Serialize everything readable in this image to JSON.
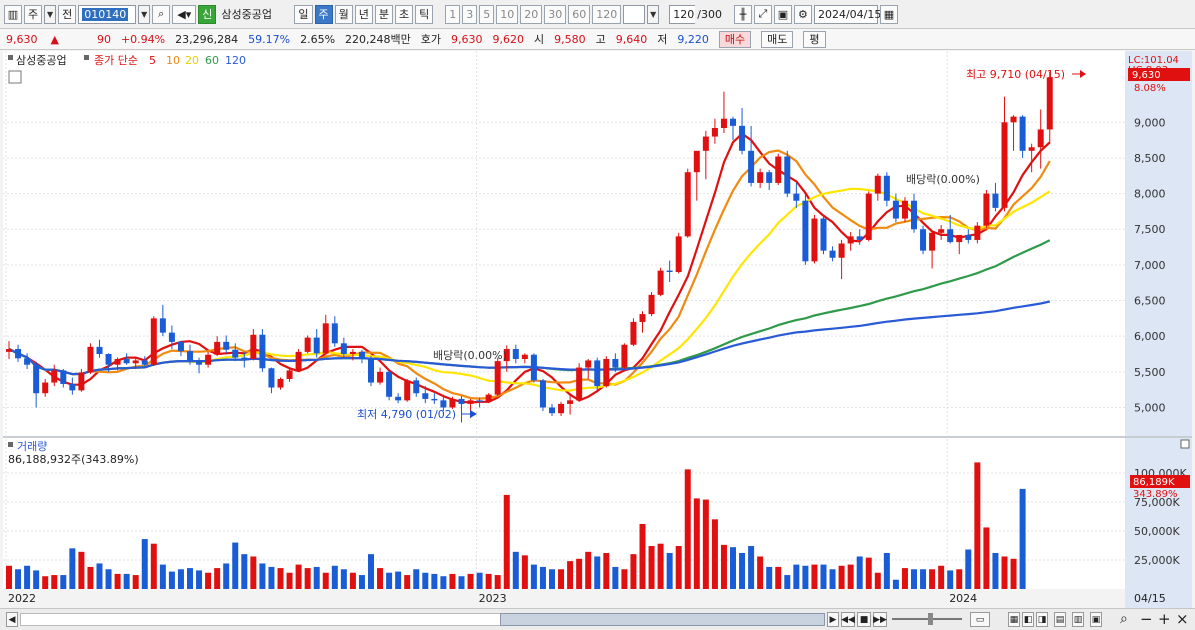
{
  "toolbar": {
    "market": "주",
    "prev_label": "전",
    "stock_code": "010140",
    "new_label": "신",
    "stock_name": "삼성중공업",
    "periods": [
      "일",
      "주",
      "월",
      "년",
      "분",
      "초",
      "틱"
    ],
    "active_period": "주",
    "intervals": [
      "1",
      "3",
      "5",
      "10",
      "20",
      "30",
      "60",
      "120"
    ],
    "count_value": "120",
    "count_total": "/300",
    "date_value": "2024/04/15"
  },
  "info": {
    "price": "9,630",
    "change_arrow": "▲",
    "change": "90",
    "change_pct": "+0.94%",
    "volume": "23,296,284",
    "vol_ratio": "59.17%",
    "turnover": "2.65%",
    "amount": "220,248백만",
    "quote_label": "호가",
    "ask": "9,630",
    "bid": "9,620",
    "open_label": "시",
    "open": "9,580",
    "high_label": "고",
    "high": "9,640",
    "low_label": "저",
    "low": "9,220",
    "buy_label": "매수",
    "sell_label": "매도",
    "eval_label": "평"
  },
  "chart_data": {
    "type": "candlestick",
    "title": "삼성중공업",
    "price_legend": {
      "label": "종가 단순",
      "ma_periods": [
        "5",
        "10",
        "20",
        "60",
        "120"
      ],
      "ma_colors": [
        "#e01010",
        "#f08a10",
        "#ffe600",
        "#2e9a4a",
        "#2a5bd6"
      ]
    },
    "lc_label": "LC:101.04",
    "hc_label": "HC:8.03",
    "current_price_label": "9,630",
    "current_pct_label": "8.08%",
    "ylim": [
      4600,
      10000
    ],
    "y_ticks": [
      5000,
      5500,
      6000,
      6500,
      7000,
      7500,
      8000,
      8500,
      9000
    ],
    "y_tick_labels": [
      "5,000",
      "5,500",
      "6,000",
      "6,500",
      "7,000",
      "7,500",
      "8,000",
      "8,500",
      "9,000"
    ],
    "x_labels": [
      "2022",
      "2023",
      "2024"
    ],
    "x_label_index": [
      0,
      52,
      104
    ],
    "last_date_label": "04/15",
    "annotations": {
      "high": "최고 9,710 (04/15)",
      "low": "최저 4,790 (01/02)",
      "dividend": "배당락(0.00%)"
    },
    "candles": [
      [
        5780,
        5930,
        5680,
        5820
      ],
      [
        5820,
        5880,
        5640,
        5690
      ],
      [
        5690,
        5760,
        5540,
        5600
      ],
      [
        5600,
        5640,
        5000,
        5200
      ],
      [
        5200,
        5400,
        5150,
        5350
      ],
      [
        5350,
        5600,
        5300,
        5520
      ],
      [
        5520,
        5540,
        5280,
        5330
      ],
      [
        5330,
        5420,
        5180,
        5240
      ],
      [
        5240,
        5540,
        5220,
        5490
      ],
      [
        5490,
        5900,
        5470,
        5850
      ],
      [
        5850,
        5950,
        5700,
        5750
      ],
      [
        5750,
        5760,
        5500,
        5600
      ],
      [
        5600,
        5700,
        5520,
        5680
      ],
      [
        5680,
        5760,
        5600,
        5620
      ],
      [
        5620,
        5700,
        5540,
        5660
      ],
      [
        5660,
        5720,
        5580,
        5600
      ],
      [
        5600,
        6280,
        5580,
        6250
      ],
      [
        6250,
        6440,
        6000,
        6050
      ],
      [
        6050,
        6150,
        5820,
        5920
      ],
      [
        5920,
        5930,
        5720,
        5790
      ],
      [
        5790,
        5880,
        5600,
        5660
      ],
      [
        5660,
        5700,
        5480,
        5600
      ],
      [
        5600,
        5780,
        5560,
        5740
      ],
      [
        5740,
        6000,
        5720,
        5920
      ],
      [
        5920,
        6010,
        5760,
        5810
      ],
      [
        5810,
        5900,
        5650,
        5700
      ],
      [
        5700,
        5780,
        5560,
        5680
      ],
      [
        5680,
        6100,
        5660,
        6020
      ],
      [
        6020,
        6100,
        5500,
        5550
      ],
      [
        5550,
        5560,
        5200,
        5280
      ],
      [
        5280,
        5420,
        5250,
        5400
      ],
      [
        5400,
        5550,
        5360,
        5520
      ],
      [
        5520,
        5820,
        5500,
        5780
      ],
      [
        5780,
        6010,
        5760,
        5980
      ],
      [
        5980,
        6100,
        5700,
        5760
      ],
      [
        5760,
        6300,
        5740,
        6180
      ],
      [
        6180,
        6280,
        5850,
        5900
      ],
      [
        5900,
        5980,
        5700,
        5750
      ],
      [
        5750,
        5820,
        5660,
        5780
      ],
      [
        5780,
        5810,
        5620,
        5680
      ],
      [
        5680,
        5720,
        5300,
        5350
      ],
      [
        5350,
        5560,
        5320,
        5500
      ],
      [
        5500,
        5520,
        5100,
        5150
      ],
      [
        5150,
        5200,
        5060,
        5100
      ],
      [
        5100,
        5400,
        5080,
        5380
      ],
      [
        5380,
        5420,
        5150,
        5200
      ],
      [
        5200,
        5300,
        5060,
        5120
      ],
      [
        5120,
        5200,
        5050,
        5100
      ],
      [
        5100,
        5180,
        4950,
        5000
      ],
      [
        5000,
        5150,
        4980,
        5120
      ],
      [
        5120,
        5160,
        4790,
        5050
      ],
      [
        5050,
        5120,
        4850,
        5100
      ],
      [
        5100,
        5140,
        5000,
        5080
      ],
      [
        5080,
        5200,
        5060,
        5180
      ],
      [
        5180,
        5700,
        5160,
        5650
      ],
      [
        5650,
        5870,
        5500,
        5820
      ],
      [
        5820,
        5880,
        5620,
        5680
      ],
      [
        5680,
        5760,
        5620,
        5740
      ],
      [
        5740,
        5760,
        5350,
        5380
      ],
      [
        5380,
        5400,
        4950,
        5000
      ],
      [
        5000,
        5050,
        4880,
        4920
      ],
      [
        4920,
        5080,
        4880,
        5050
      ],
      [
        5050,
        5200,
        4900,
        5100
      ],
      [
        5100,
        5620,
        5080,
        5560
      ],
      [
        5560,
        5680,
        5400,
        5660
      ],
      [
        5660,
        5700,
        5240,
        5300
      ],
      [
        5300,
        5720,
        5280,
        5680
      ],
      [
        5680,
        5760,
        5500,
        5560
      ],
      [
        5560,
        5900,
        5540,
        5880
      ],
      [
        5880,
        6250,
        5860,
        6200
      ],
      [
        6200,
        6350,
        6050,
        6310
      ],
      [
        6310,
        6620,
        6280,
        6580
      ],
      [
        6580,
        6960,
        6560,
        6920
      ],
      [
        6920,
        7060,
        6760,
        6900
      ],
      [
        6900,
        7450,
        6880,
        7400
      ],
      [
        7400,
        8350,
        7380,
        8300
      ],
      [
        8300,
        8480,
        7900,
        8600
      ],
      [
        8600,
        8880,
        8200,
        8800
      ],
      [
        8800,
        9050,
        8700,
        8920
      ],
      [
        8920,
        9430,
        8850,
        9050
      ],
      [
        9050,
        9080,
        8750,
        8950
      ],
      [
        8950,
        9200,
        8550,
        8600
      ],
      [
        8600,
        8950,
        8100,
        8150
      ],
      [
        8150,
        8350,
        8080,
        8300
      ],
      [
        8300,
        8330,
        8050,
        8150
      ],
      [
        8150,
        8560,
        8120,
        8520
      ],
      [
        8520,
        8600,
        7950,
        8000
      ],
      [
        8000,
        8150,
        7800,
        7900
      ],
      [
        7900,
        8000,
        7000,
        7050
      ],
      [
        7050,
        7700,
        7020,
        7650
      ],
      [
        7650,
        7700,
        7150,
        7200
      ],
      [
        7200,
        7260,
        7050,
        7100
      ],
      [
        7100,
        7350,
        6800,
        7300
      ],
      [
        7300,
        7460,
        7200,
        7400
      ],
      [
        7400,
        7500,
        7280,
        7350
      ],
      [
        7350,
        8030,
        7330,
        8000
      ],
      [
        8000,
        8280,
        7900,
        8250
      ],
      [
        8250,
        8300,
        7820,
        7900
      ],
      [
        7900,
        8000,
        7600,
        7650
      ],
      [
        7650,
        7950,
        7600,
        7900
      ],
      [
        7900,
        8000,
        7450,
        7500
      ],
      [
        7500,
        7550,
        7150,
        7200
      ],
      [
        7200,
        7480,
        6950,
        7450
      ],
      [
        7450,
        7560,
        7350,
        7500
      ],
      [
        7500,
        7700,
        7300,
        7320
      ],
      [
        7320,
        7400,
        7150,
        7420
      ],
      [
        7420,
        7500,
        7300,
        7350
      ],
      [
        7350,
        7600,
        7300,
        7550
      ],
      [
        7550,
        8050,
        7520,
        8000
      ],
      [
        8000,
        8150,
        7750,
        7800
      ],
      [
        7800,
        9360,
        7750,
        9000
      ],
      [
        9000,
        9100,
        8600,
        9080
      ],
      [
        9080,
        9100,
        8500,
        8600
      ],
      [
        8600,
        8700,
        8300,
        8650
      ],
      [
        8650,
        9180,
        8350,
        8900
      ],
      [
        8900,
        9710,
        8700,
        9630
      ]
    ],
    "ma": {
      "5": [
        5820,
        5760,
        5700,
        5620,
        5530,
        5430,
        5360,
        5320,
        5320,
        5400,
        5520,
        5580,
        5660,
        5700,
        5700,
        5660,
        5760,
        5830,
        5880,
        5920,
        5930,
        5890,
        5800,
        5750,
        5760,
        5770,
        5760,
        5820,
        5780,
        5710,
        5610,
        5550,
        5510,
        5560,
        5660,
        5760,
        5810,
        5850,
        5850,
        5850,
        5760,
        5650,
        5520,
        5430,
        5370,
        5330,
        5270,
        5220,
        5160,
        5110,
        5080,
        5070,
        5080,
        5080,
        5140,
        5240,
        5380,
        5500,
        5550,
        5510,
        5420,
        5290,
        5180,
        5100,
        5150,
        5230,
        5330,
        5460,
        5520,
        5560,
        5690,
        5890,
        6080,
        6340,
        6580,
        6840,
        7220,
        7620,
        8010,
        8440,
        8720,
        8840,
        8750,
        8580,
        8420,
        8330,
        8250,
        8170,
        8010,
        7800,
        7690,
        7600,
        7460,
        7340,
        7330,
        7450,
        7610,
        7740,
        7820,
        7830,
        7720,
        7590,
        7470,
        7420,
        7420,
        7380,
        7410,
        7430,
        7500,
        7680,
        7830,
        8020,
        8260,
        8440,
        8600,
        8720
      ]
    },
    "volume": {
      "ylim": [
        0,
        130000
      ],
      "y_ticks": [
        25000,
        50000,
        75000,
        100000
      ],
      "y_tick_labels": [
        "25,000K",
        "50,000K",
        "75,000K",
        "100,000K"
      ],
      "title": "거래량",
      "current_label": "86,188,932주(343.89%)",
      "current_box": "86,189K",
      "current_pct": "343.89%",
      "values": [
        20000,
        17000,
        20000,
        16000,
        11000,
        12000,
        12000,
        35000,
        32000,
        19000,
        22000,
        17000,
        13000,
        13000,
        12000,
        43000,
        39000,
        21000,
        15000,
        17000,
        18000,
        16000,
        14000,
        18000,
        22000,
        40000,
        30000,
        28000,
        22000,
        19000,
        18000,
        14000,
        21000,
        18000,
        19000,
        14000,
        20000,
        17000,
        14000,
        12000,
        30000,
        18000,
        14000,
        15000,
        12000,
        17000,
        14000,
        13000,
        11000,
        13000,
        11000,
        13000,
        14000,
        13000,
        12000,
        81000,
        32000,
        29000,
        21000,
        19000,
        17000,
        17000,
        24000,
        26000,
        32000,
        28000,
        31000,
        19000,
        17000,
        30000,
        56000,
        37000,
        39000,
        31000,
        37000,
        103000,
        78000,
        77000,
        60000,
        38000,
        36000,
        31000,
        37000,
        28000,
        19000,
        19000,
        12000,
        21000,
        20000,
        21000,
        21000,
        17000,
        20000,
        21000,
        28000,
        27000,
        14000,
        31000,
        8000,
        18000,
        17000,
        17000,
        17000,
        20000,
        16000,
        17000,
        34000,
        109000,
        53000,
        31000,
        28000,
        26000,
        86189
      ]
    }
  }
}
